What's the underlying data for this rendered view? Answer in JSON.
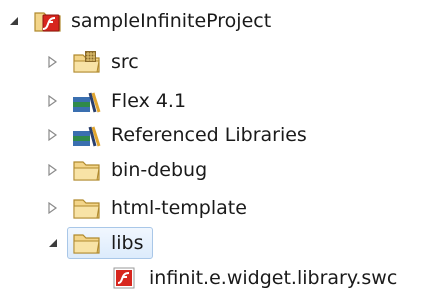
{
  "explorer": {
    "project": {
      "label": "sampleInfiniteProject",
      "expanded": true,
      "icon": "flex-project-icon"
    },
    "children": [
      {
        "label": "src",
        "icon": "source-folder-icon",
        "expanded": false
      },
      {
        "label": "Flex 4.1",
        "icon": "library-container-icon",
        "expanded": false
      },
      {
        "label": "Referenced Libraries",
        "icon": "library-container-icon",
        "expanded": false
      },
      {
        "label": "bin-debug",
        "icon": "folder-icon",
        "expanded": false
      },
      {
        "label": "html-template",
        "icon": "folder-icon",
        "expanded": false
      },
      {
        "label": "libs",
        "icon": "folder-icon",
        "expanded": true,
        "selected": true
      }
    ],
    "libs_children": [
      {
        "label": "infinit.e.widget.library.swc",
        "icon": "swc-file-icon"
      }
    ]
  },
  "colors": {
    "selection_border": "#a9c7e8",
    "selection_fill": "#dcebfc",
    "folder_fill": "#f3d58a",
    "folder_stroke": "#b08a2e",
    "flash_red": "#d7261e"
  }
}
